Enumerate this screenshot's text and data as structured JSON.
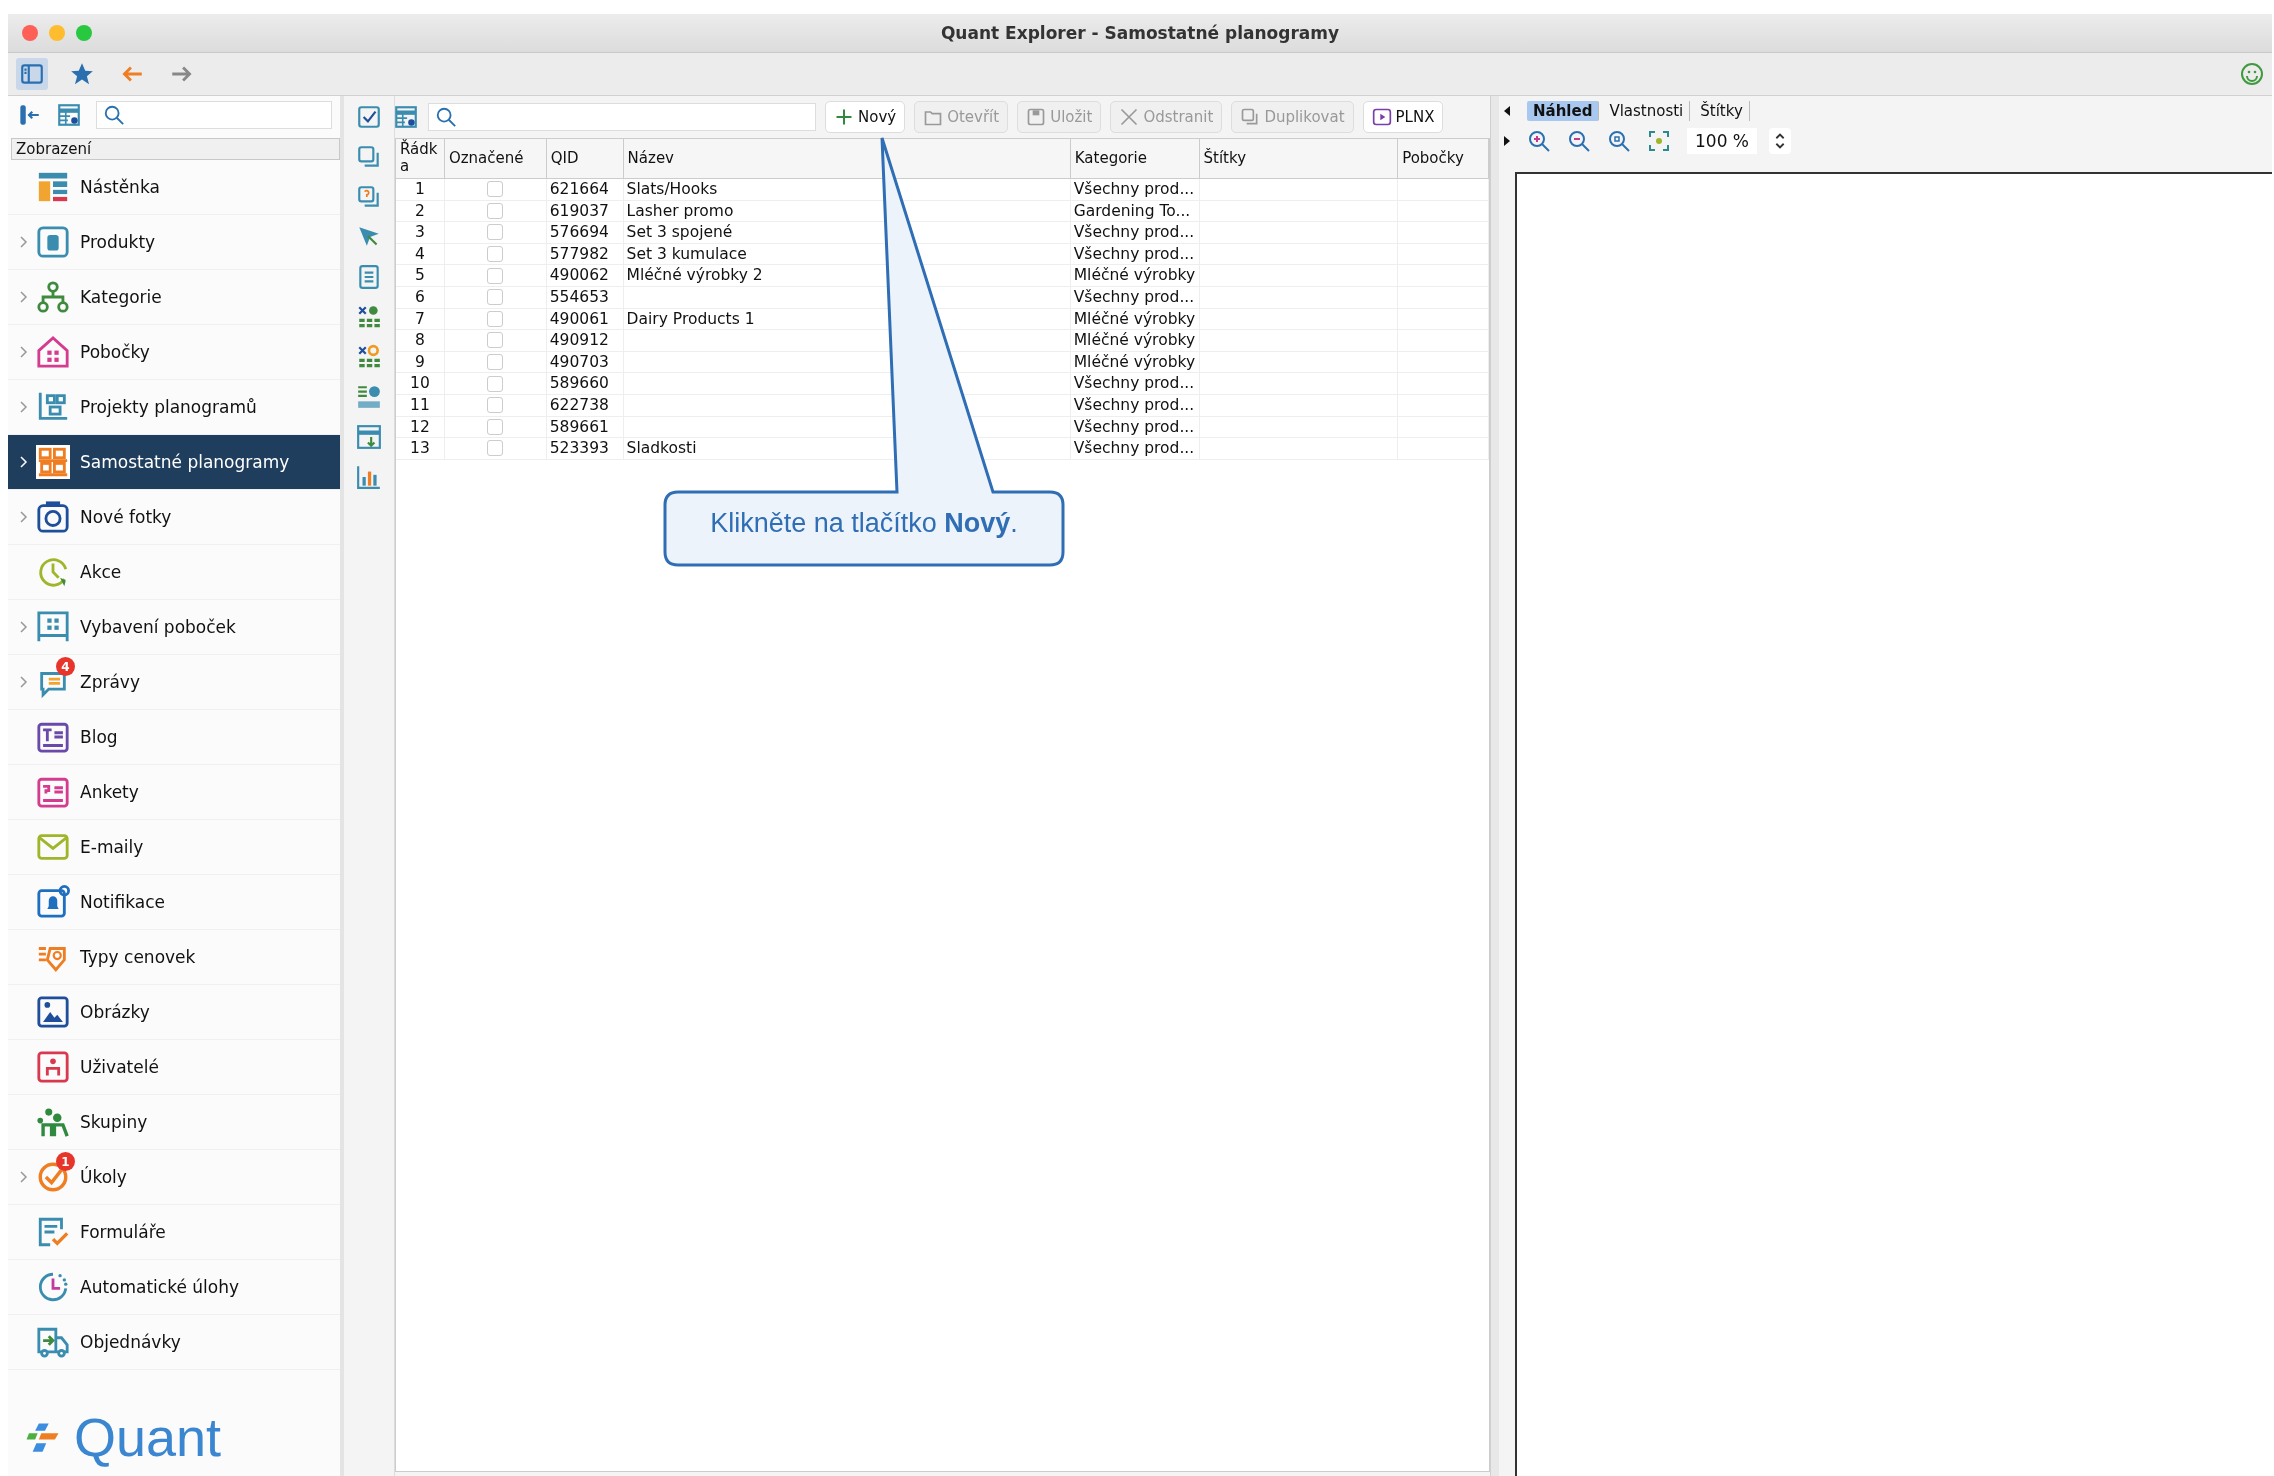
{
  "window": {
    "title": "Quant Explorer - Samostatné planogramy"
  },
  "sidebar": {
    "header": "Zobrazení",
    "items": [
      {
        "label": "Nástěnka",
        "expandable": false,
        "selected": false
      },
      {
        "label": "Produkty",
        "expandable": true,
        "selected": false
      },
      {
        "label": "Kategorie",
        "expandable": true,
        "selected": false
      },
      {
        "label": "Pobočky",
        "expandable": true,
        "selected": false
      },
      {
        "label": "Projekty planogramů",
        "expandable": true,
        "selected": false
      },
      {
        "label": "Samostatné planogramy",
        "expandable": true,
        "selected": true
      },
      {
        "label": "Nové fotky",
        "expandable": true,
        "selected": false
      },
      {
        "label": "Akce",
        "expandable": false,
        "selected": false
      },
      {
        "label": "Vybavení poboček",
        "expandable": true,
        "selected": false
      },
      {
        "label": "Zprávy",
        "expandable": true,
        "selected": false,
        "badge": "4"
      },
      {
        "label": "Blog",
        "expandable": false,
        "selected": false
      },
      {
        "label": "Ankety",
        "expandable": false,
        "selected": false
      },
      {
        "label": "E-maily",
        "expandable": false,
        "selected": false
      },
      {
        "label": "Notifikace",
        "expandable": false,
        "selected": false
      },
      {
        "label": "Typy cenovek",
        "expandable": false,
        "selected": false
      },
      {
        "label": "Obrázky",
        "expandable": false,
        "selected": false
      },
      {
        "label": "Uživatelé",
        "expandable": false,
        "selected": false
      },
      {
        "label": "Skupiny",
        "expandable": false,
        "selected": false
      },
      {
        "label": "Úkoly",
        "expandable": true,
        "selected": false,
        "badge": "1"
      },
      {
        "label": "Formuláře",
        "expandable": false,
        "selected": false
      },
      {
        "label": "Automatické úlohy",
        "expandable": false,
        "selected": false
      },
      {
        "label": "Objednávky",
        "expandable": false,
        "selected": false
      }
    ],
    "logo": "Quant"
  },
  "toolbar": {
    "buttons": [
      {
        "label": "Nový",
        "disabled": false
      },
      {
        "label": "Otevřít",
        "disabled": true
      },
      {
        "label": "Uložit",
        "disabled": true
      },
      {
        "label": "Odstranit",
        "disabled": true
      },
      {
        "label": "Duplikovat",
        "disabled": true
      },
      {
        "label": "PLNX",
        "disabled": false
      }
    ]
  },
  "table": {
    "columns": [
      "Řádka",
      "Označené",
      "QID",
      "Název",
      "Kategorie",
      "Štítky",
      "Pobočky"
    ],
    "rows": [
      {
        "row": "1",
        "checked": false,
        "qid": "621664",
        "name": "Slats/Hooks",
        "category": "Všechny prod..."
      },
      {
        "row": "2",
        "checked": false,
        "qid": "619037",
        "name": "Lasher promo",
        "category": "Gardening To..."
      },
      {
        "row": "3",
        "checked": false,
        "qid": "576694",
        "name": "Set 3 spojené",
        "category": "Všechny prod..."
      },
      {
        "row": "4",
        "checked": false,
        "qid": "577982",
        "name": "Set 3 kumulace",
        "category": "Všechny prod..."
      },
      {
        "row": "5",
        "checked": false,
        "qid": "490062",
        "name": "Mléčné výrobky 2",
        "category": "Mléčné výrobky"
      },
      {
        "row": "6",
        "checked": false,
        "qid": "554653",
        "category": "Všechny prod..."
      },
      {
        "row": "7",
        "checked": false,
        "qid": "490061",
        "name": "Dairy Products 1",
        "category": "Mléčné výrobky"
      },
      {
        "row": "8",
        "checked": false,
        "qid": "490912",
        "category": "Mléčné výrobky"
      },
      {
        "row": "9",
        "checked": false,
        "qid": "490703",
        "category": "Mléčné výrobky"
      },
      {
        "row": "10",
        "checked": false,
        "qid": "589660",
        "category": "Všechny prod..."
      },
      {
        "row": "11",
        "checked": false,
        "qid": "622738",
        "category": "Všechny prod..."
      },
      {
        "row": "12",
        "checked": false,
        "qid": "589661",
        "category": "Všechny prod..."
      },
      {
        "row": "13",
        "checked": false,
        "qid": "523393",
        "name": "Sladkosti",
        "category": "Všechny prod..."
      }
    ]
  },
  "preview": {
    "tabs": [
      {
        "label": "Náhled",
        "selected": true
      },
      {
        "label": "Vlastnosti",
        "selected": false
      },
      {
        "label": "Štítky",
        "selected": false
      }
    ],
    "zoom": "100 %"
  },
  "callout": {
    "text": "Klikněte na tlačítko **Nový**."
  }
}
